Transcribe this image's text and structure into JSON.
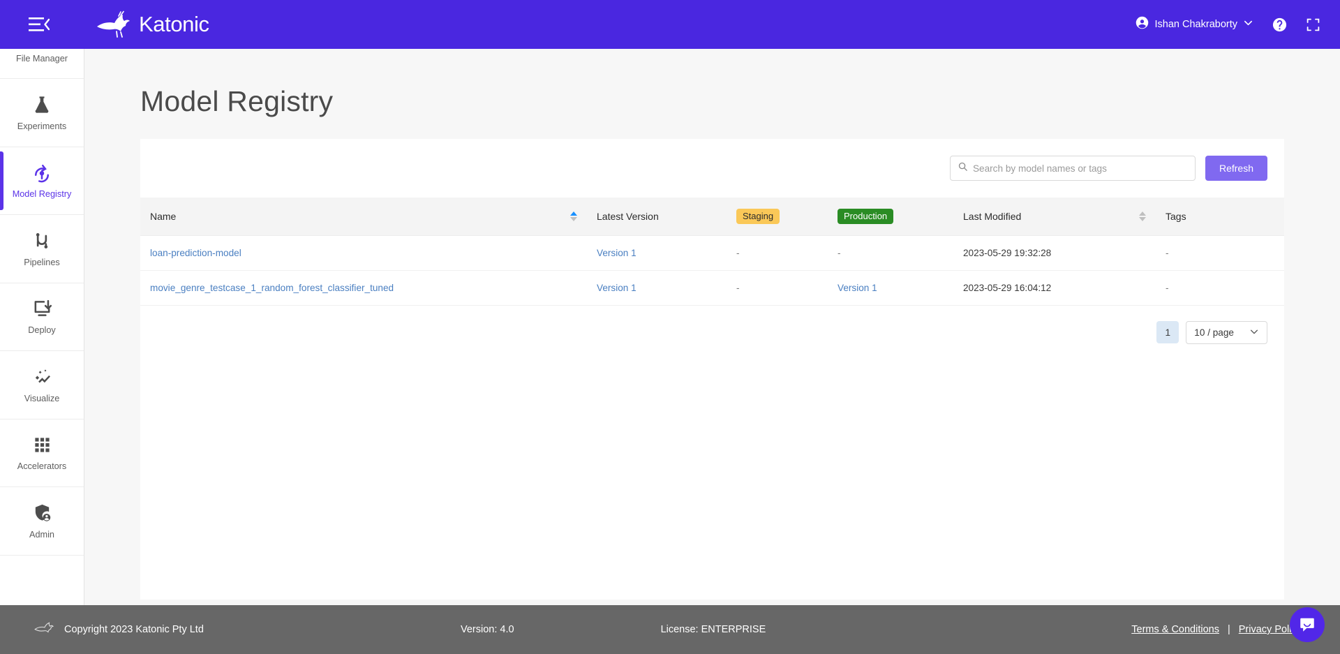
{
  "topbar": {
    "brand_name": "Katonic",
    "menu_icon": "hamburger-collapse-icon",
    "user_name": "Ishan Chakraborty",
    "account_icon": "account-circle-icon",
    "chevron_icon": "chevron-down-icon",
    "help_icon": "help-circle-icon",
    "fullscreen_icon": "fullscreen-icon",
    "brand_color": "#4a27e0"
  },
  "sidebar": {
    "items": [
      {
        "label": "File Manager",
        "icon": "folder-icon",
        "active": false
      },
      {
        "label": "Experiments",
        "icon": "flask-icon",
        "active": false
      },
      {
        "label": "Model Registry",
        "icon": "model-registry-icon",
        "active": true
      },
      {
        "label": "Pipelines",
        "icon": "pipelines-icon",
        "active": false
      },
      {
        "label": "Deploy",
        "icon": "deploy-download-icon",
        "active": false
      },
      {
        "label": "Visualize",
        "icon": "visualize-sparkle-icon",
        "active": false
      },
      {
        "label": "Accelerators",
        "icon": "grid-apps-icon",
        "active": false
      },
      {
        "label": "Admin",
        "icon": "admin-shield-user-icon",
        "active": false
      }
    ],
    "active_color": "#5b33e8"
  },
  "main": {
    "page_title": "Model Registry",
    "search": {
      "placeholder": "Search by model names or tags",
      "value": "",
      "icon": "search-icon"
    },
    "refresh_label": "Refresh",
    "refresh_color": "#8069f0"
  },
  "table": {
    "columns": [
      {
        "label": "Name",
        "sortable": true,
        "sort": "asc",
        "badge": null
      },
      {
        "label": "Latest Version",
        "sortable": true,
        "sort": "none",
        "badge": null
      },
      {
        "label": "Staging",
        "sortable": false,
        "sort": null,
        "badge": "staging"
      },
      {
        "label": "Production",
        "sortable": false,
        "sort": null,
        "badge": "production"
      },
      {
        "label": "Last Modified",
        "sortable": true,
        "sort": "none",
        "badge": null
      },
      {
        "label": "Tags",
        "sortable": false,
        "sort": null,
        "badge": null
      }
    ],
    "badge_colors": {
      "staging": "#fac858",
      "production": "#2a8c24"
    },
    "rows": [
      {
        "name": "loan-prediction-model",
        "latest_version": "Version 1",
        "staging": "-",
        "production": "-",
        "last_modified": "2023-05-29 19:32:28",
        "tags": "-"
      },
      {
        "name": "movie_genre_testcase_1_random_forest_classifier_tuned",
        "latest_version": "Version 1",
        "staging": "-",
        "production": "Version 1",
        "last_modified": "2023-05-29 16:04:12",
        "tags": "-"
      }
    ]
  },
  "pagination": {
    "current_page": "1",
    "page_size_label": "10 / page",
    "chevron_icon": "chevron-down-icon"
  },
  "footer": {
    "copyright": "Copyright 2023 Katonic Pty Ltd",
    "version": "Version: 4.0",
    "license": "License: ENTERPRISE",
    "terms_label": "Terms & Conditions",
    "separator": "|",
    "privacy_label": "Privacy Policy",
    "logo_icon": "katonic-kangaroo-icon",
    "background": "#676767"
  },
  "chat": {
    "icon": "chat-bubble-icon",
    "color": "#5127e8"
  }
}
